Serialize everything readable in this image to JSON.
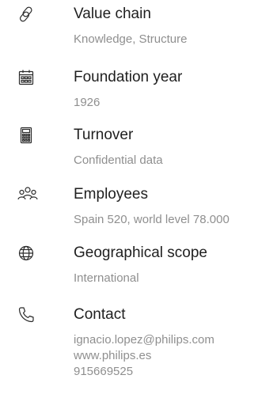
{
  "items": [
    {
      "icon": "link-icon",
      "title": "Value chain",
      "value": "Knowledge, Structure"
    },
    {
      "icon": "calendar-icon",
      "title": "Foundation year",
      "value": "1926"
    },
    {
      "icon": "calculator-icon",
      "title": "Turnover",
      "value": "Confidential data"
    },
    {
      "icon": "people-icon",
      "title": "Employees",
      "value": "Spain 520, world level 78.000"
    },
    {
      "icon": "globe-icon",
      "title": "Geographical scope",
      "value": "International"
    },
    {
      "icon": "phone-icon",
      "title": "Contact"
    }
  ],
  "contact": {
    "email": "ignacio.lopez@philips.com",
    "website": "www.philips.es",
    "phone": "915669525"
  }
}
